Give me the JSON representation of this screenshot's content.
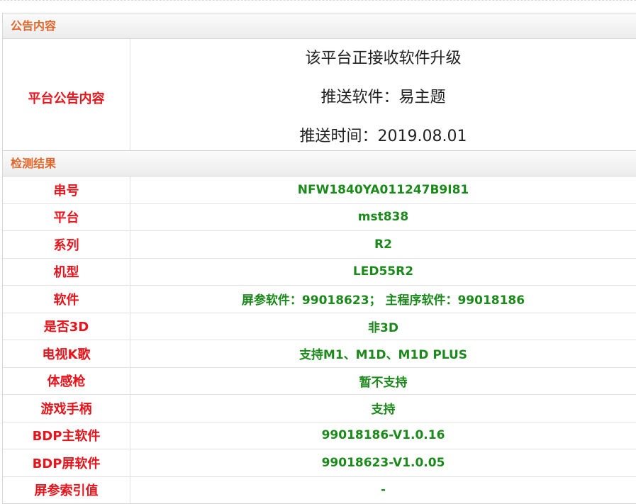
{
  "notice_panel": {
    "title": "公告内容",
    "label": "平台公告内容",
    "lines": [
      "该平台正接收软件升级",
      "推送软件：易主题",
      "推送时间：2019.08.01"
    ]
  },
  "result_panel": {
    "title": "检测结果",
    "rows": [
      {
        "label": "串号",
        "value": "NFW1840YA011247B9I81"
      },
      {
        "label": "平台",
        "value": "mst838"
      },
      {
        "label": "系列",
        "value": "R2"
      },
      {
        "label": "机型",
        "value": "LED55R2"
      },
      {
        "label": "软件",
        "value": "屏参软件：99018623； 主程序软件：99018186"
      },
      {
        "label": "是否3D",
        "value": "非3D"
      },
      {
        "label": "电视K歌",
        "value": "支持M1、M1D、M1D PLUS"
      },
      {
        "label": "体感枪",
        "value": "暂不支持"
      },
      {
        "label": "游戏手柄",
        "value": "支持"
      },
      {
        "label": "BDP主软件",
        "value": "99018186-V1.0.16"
      },
      {
        "label": "BDP屏软件",
        "value": "99018623-V1.0.05"
      },
      {
        "label": "屏参索引值",
        "value": "-"
      }
    ]
  },
  "colors": {
    "header_text": "#e0662a",
    "label_text": "#e8141b",
    "value_text": "#1b8a1b"
  }
}
